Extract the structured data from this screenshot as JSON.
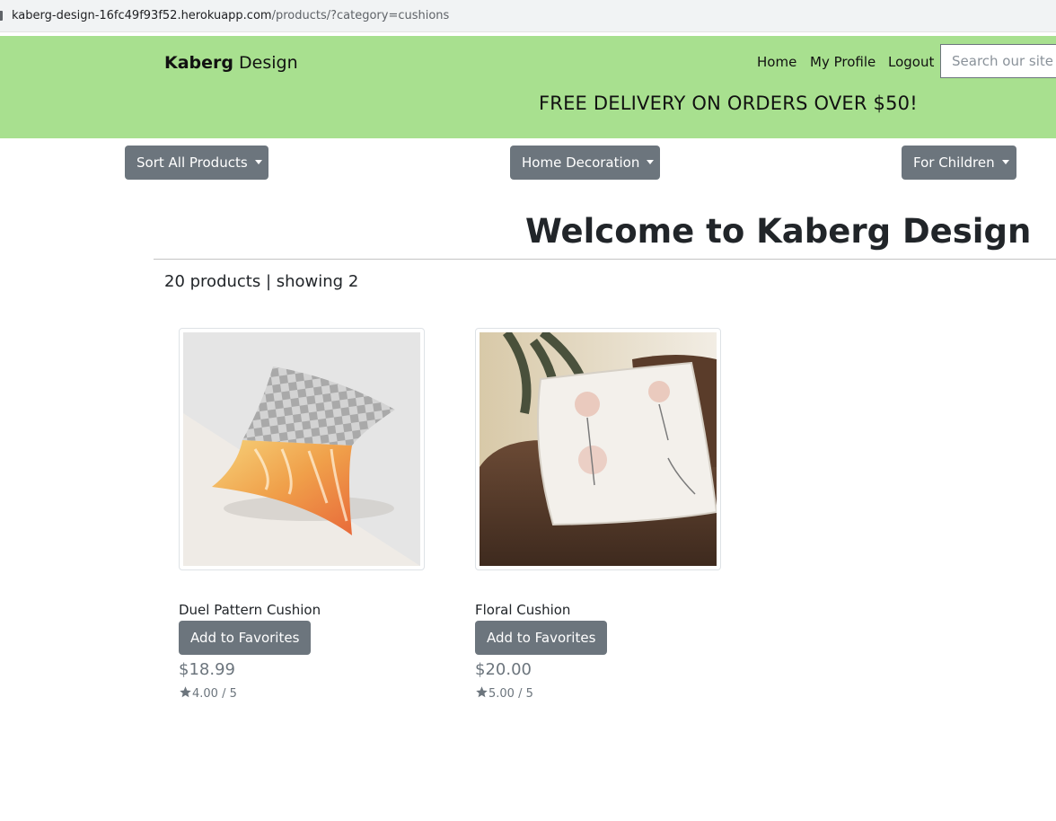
{
  "browser": {
    "url_host": "kaberg-design-16fc49f93f52.herokuapp.com",
    "url_path": "/products/?category=cushions"
  },
  "header": {
    "brand_bold": "Kaberg",
    "brand_rest": " Design",
    "nav": [
      "Home",
      "My Profile",
      "Logout"
    ],
    "search_placeholder": "Search our site",
    "banner": "FREE DELIVERY ON ORDERS OVER $50!"
  },
  "menus": [
    "Sort All Products",
    "Home Decoration",
    "For Children"
  ],
  "main": {
    "welcome": "Welcome to Kaberg Design",
    "count": "20 products | showing 2"
  },
  "products": [
    {
      "name": "Duel Pattern Cushion",
      "button": "Add to Favorites",
      "price": "$18.99",
      "rating": "4.00 / 5"
    },
    {
      "name": "Floral Cushion",
      "button": "Add to Favorites",
      "price": "$20.00",
      "rating": "5.00 / 5"
    }
  ],
  "colors": {
    "navbar": "#a8e08f",
    "button": "#6c757d"
  }
}
